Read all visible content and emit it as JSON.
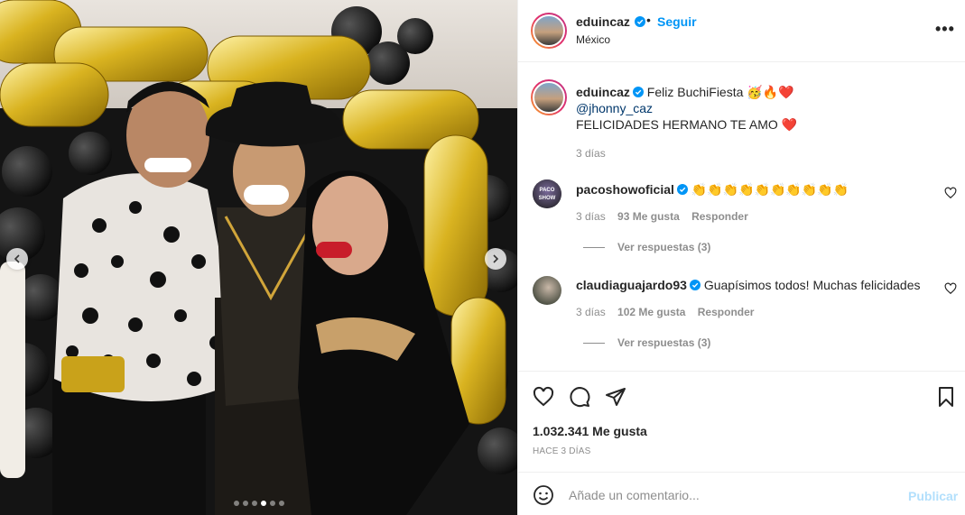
{
  "post": {
    "author": "eduincaz",
    "location": "México",
    "follow_label": "Seguir",
    "separator": "•",
    "more_label": "•••",
    "carousel": {
      "count": 6,
      "active_index": 3
    }
  },
  "caption": {
    "username": "eduincaz",
    "line1": "Feliz BuchiFiesta 🥳🔥❤️",
    "mention": "@jhonny_caz",
    "line3": "FELICIDADES HERMANO TE AMO ❤️",
    "time": "3 días"
  },
  "comments": [
    {
      "username": "pacoshowoficial",
      "text": "👏👏👏👏👏👏👏👏👏👏",
      "time": "3 días",
      "likes": "93 Me gusta",
      "reply_label": "Responder",
      "view_replies": "Ver respuestas (3)",
      "avatar_text": "PACO SHOW"
    },
    {
      "username": "claudiaguajardo93",
      "text": "Guapísimos todos! Muchas felicidades",
      "time": "3 días",
      "likes": "102 Me gusta",
      "reply_label": "Responder",
      "view_replies": "Ver respuestas (3)"
    }
  ],
  "stats": {
    "likes": "1.032.341 Me gusta",
    "posted": "HACE 3 DÍAS"
  },
  "composer": {
    "placeholder": "Añade un comentario...",
    "publish_label": "Publicar"
  },
  "icons": [
    "heart-icon",
    "comment-icon",
    "share-icon",
    "bookmark-icon",
    "emoji-icon",
    "verified-badge-icon",
    "chevron-left-icon",
    "chevron-right-icon"
  ],
  "colors": {
    "link": "#0095f6",
    "mention": "#00376b",
    "muted": "#8e8e8e",
    "publish_disabled": "#b2dffc",
    "verified": "#0095f6"
  }
}
